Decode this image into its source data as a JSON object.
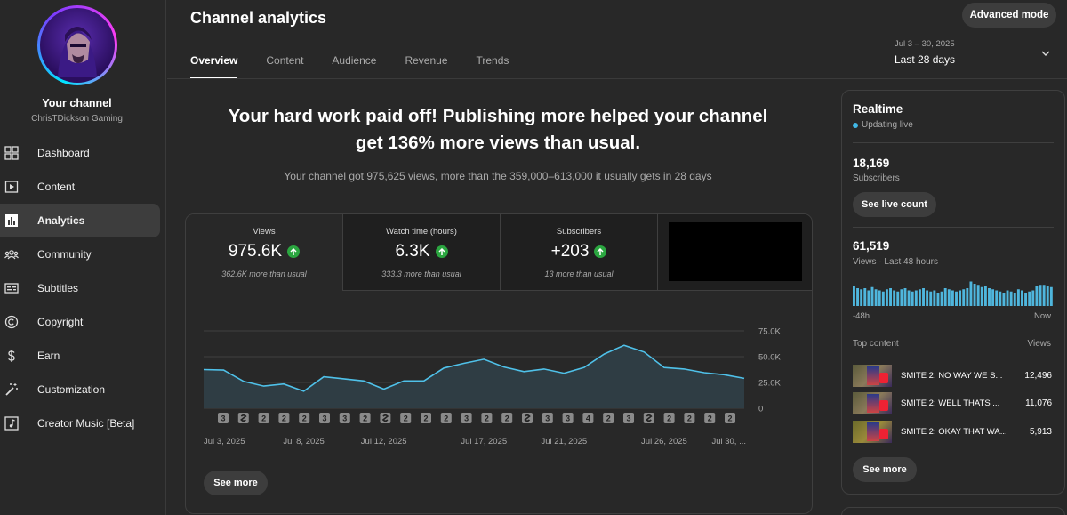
{
  "sidebar": {
    "channel_name": "Your channel",
    "channel_handle": "ChrisTDickson Gaming",
    "items": [
      {
        "label": "Dashboard",
        "icon": "dashboard-icon"
      },
      {
        "label": "Content",
        "icon": "content-icon"
      },
      {
        "label": "Analytics",
        "icon": "analytics-icon",
        "active": true
      },
      {
        "label": "Community",
        "icon": "community-icon"
      },
      {
        "label": "Subtitles",
        "icon": "subtitles-icon"
      },
      {
        "label": "Copyright",
        "icon": "copyright-icon"
      },
      {
        "label": "Earn",
        "icon": "dollar-icon"
      },
      {
        "label": "Customization",
        "icon": "magic-wand-icon"
      },
      {
        "label": "Creator Music [Beta]",
        "icon": "music-icon"
      }
    ]
  },
  "header": {
    "title": "Channel analytics",
    "advanced_mode": "Advanced mode",
    "tabs": [
      "Overview",
      "Content",
      "Audience",
      "Revenue",
      "Trends"
    ],
    "date_range": "Jul 3 – 30, 2025",
    "date_preset": "Last 28 days"
  },
  "summary": {
    "headline_1": "Your hard work paid off! Publishing more helped your channel",
    "headline_2": "get 136% more views than usual.",
    "subline": "Your channel got 975,625 views, more than the 359,000–613,000 it usually gets in 28 days"
  },
  "metrics": [
    {
      "label": "Views",
      "value": "975.6K",
      "sub": "362.6K more than usual"
    },
    {
      "label": "Watch time (hours)",
      "value": "6.3K",
      "sub": "333.3 more than usual"
    },
    {
      "label": "Subscribers",
      "value": "+203",
      "sub": "13 more than usual"
    }
  ],
  "chart_data": {
    "type": "area",
    "ylim": [
      0,
      75000
    ],
    "y_ticks": [
      "75.0K",
      "50.0K",
      "25.0K",
      "0"
    ],
    "y_tick_values": [
      75000,
      50000,
      25000,
      0
    ],
    "x_tick_labels": [
      "Jul 3, 2025",
      "Jul 8, 2025",
      "Jul 12, 2025",
      "Jul 17, 2025",
      "Jul 21, 2025",
      "Jul 26, 2025",
      "Jul 30, ..."
    ],
    "x_tick_days": [
      0,
      5,
      9,
      14,
      18,
      23,
      27
    ],
    "series": [
      {
        "values": [
          37500,
          37000,
          26000,
          21500,
          23500,
          16500,
          30500,
          28500,
          26500,
          18500,
          26500,
          26500,
          39000,
          43500,
          47500,
          40000,
          35500,
          38000,
          34000,
          39500,
          52500,
          61000,
          54500,
          39500,
          38000,
          34500,
          32500,
          29000
        ]
      }
    ],
    "line_color": "#4fc1e9",
    "upload_markers": [
      "3",
      "shorts",
      "2",
      "2",
      "2",
      "3",
      "3",
      "2",
      "shorts",
      "2",
      "2",
      "2",
      "3",
      "2",
      "2",
      "shorts",
      "3",
      "3",
      "4",
      "2",
      "3",
      "shorts",
      "2",
      "2",
      "2",
      "2"
    ]
  },
  "see_more": "See more",
  "realtime": {
    "title": "Realtime",
    "status": "Updating live",
    "subscribers_value": "18,169",
    "subscribers_label": "Subscribers",
    "live_count_button": "See live count",
    "views_value": "61,519",
    "views_label": "Views · Last 48 hours",
    "axis_left": "-48h",
    "axis_right": "Now",
    "bars": [
      18,
      16,
      15,
      16,
      14,
      17,
      15,
      14,
      13,
      15,
      16,
      14,
      13,
      15,
      16,
      14,
      13,
      14,
      15,
      16,
      14,
      13,
      14,
      12,
      13,
      16,
      15,
      14,
      13,
      14,
      15,
      16,
      22,
      20,
      19,
      17,
      18,
      16,
      15,
      14,
      13,
      12,
      14,
      13,
      12,
      15,
      14,
      12,
      13,
      14,
      18,
      19,
      19,
      18,
      17
    ],
    "top_content_label": "Top content",
    "views_column": "Views",
    "top_content": [
      {
        "title": "SMITE 2: NO WAY WE S...",
        "views": "12,496"
      },
      {
        "title": "SMITE 2: WELL THATS ...",
        "views": "11,076"
      },
      {
        "title": "SMITE 2: OKAY THAT WA...",
        "views": "5,913"
      }
    ],
    "see_more": "See more"
  }
}
